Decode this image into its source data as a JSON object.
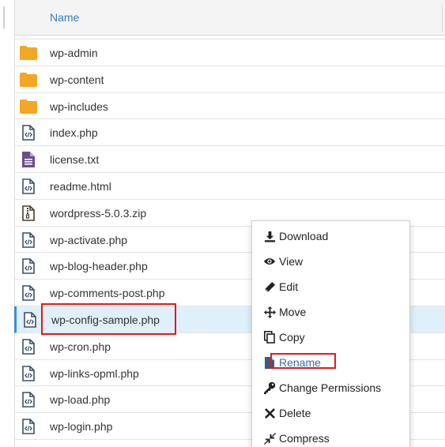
{
  "table": {
    "header": {
      "name_label": "Name"
    },
    "rows": [
      {
        "name": "wp-admin",
        "type": "folder"
      },
      {
        "name": "wp-content",
        "type": "folder"
      },
      {
        "name": "wp-includes",
        "type": "folder"
      },
      {
        "name": "index.php",
        "type": "code"
      },
      {
        "name": "license.txt",
        "type": "text"
      },
      {
        "name": "readme.html",
        "type": "code"
      },
      {
        "name": "wordpress-5.0.3.zip",
        "type": "zip"
      },
      {
        "name": "wp-activate.php",
        "type": "code"
      },
      {
        "name": "wp-blog-header.php",
        "type": "code"
      },
      {
        "name": "wp-comments-post.php",
        "type": "code"
      },
      {
        "name": "wp-config-sample.php",
        "type": "code",
        "selected": true
      },
      {
        "name": "wp-cron.php",
        "type": "code"
      },
      {
        "name": "wp-links-opml.php",
        "type": "code"
      },
      {
        "name": "wp-load.php",
        "type": "code"
      },
      {
        "name": "wp-login.php",
        "type": "code"
      }
    ]
  },
  "context_menu": {
    "items": [
      {
        "label": "Download",
        "icon": "download-icon"
      },
      {
        "label": "View",
        "icon": "eye-icon"
      },
      {
        "label": "Edit",
        "icon": "pencil-icon"
      },
      {
        "label": "Move",
        "icon": "move-arrows-icon"
      },
      {
        "label": "Copy",
        "icon": "copy-icon"
      },
      {
        "label": "Rename",
        "icon": "file-icon"
      },
      {
        "label": "Change Permissions",
        "icon": "key-icon"
      },
      {
        "label": "Delete",
        "icon": "x-icon"
      },
      {
        "label": "Compress",
        "icon": "compress-icon"
      }
    ]
  },
  "colors": {
    "folder": "#f5a623",
    "link_blue": "#2f7fc1",
    "selected_row": "#dff0fb",
    "annotation_red": "#e01b1b"
  }
}
